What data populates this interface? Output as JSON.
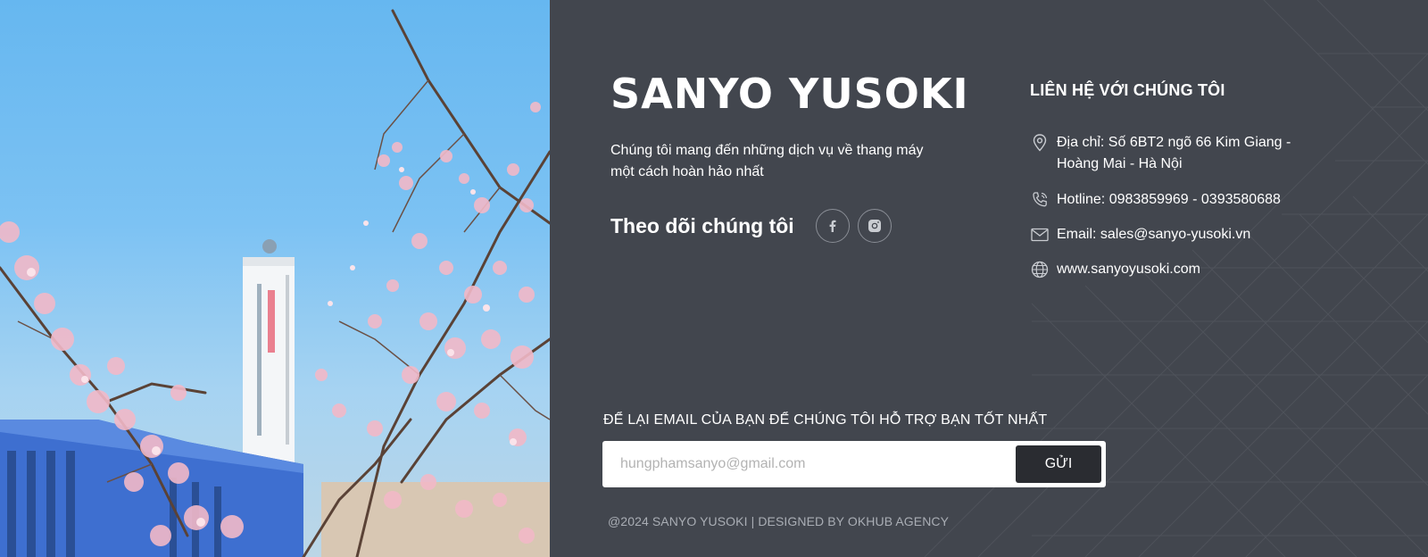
{
  "brand": {
    "logo_text": "SANYO YUSOKI",
    "tagline": "Chúng tôi mang đến những dịch vụ về thang máy một cách hoàn hảo nhất"
  },
  "social": {
    "label": "Theo dõi chúng tôi",
    "items": [
      {
        "name": "facebook",
        "icon": "facebook-icon"
      },
      {
        "name": "instagram",
        "icon": "instagram-icon"
      }
    ]
  },
  "contact": {
    "title": "LIÊN HỆ VỚI CHÚNG TÔI",
    "address": "Địa chỉ: Số 6BT2 ngõ 66 Kim Giang - Hoàng Mai - Hà Nội",
    "hotline": "Hotline: 0983859969 - 0393580688",
    "email": "Email: sales@sanyo-yusoki.vn",
    "website": "www.sanyoyusoki.com"
  },
  "subscribe": {
    "title": "ĐỂ LẠI EMAIL CỦA BẠN ĐỂ CHÚNG TÔI HỖ TRỢ BẠN TỐT NHẤT",
    "placeholder": "hungphamsanyo@gmail.com",
    "button": "GỬI"
  },
  "copyright": "@2024 SANYO YUSOKI | DESIGNED BY OKHUB AGENCY",
  "colors": {
    "panel_bg": "#42464e",
    "button_bg": "#2a2c31",
    "sky": "#66b7f0"
  }
}
